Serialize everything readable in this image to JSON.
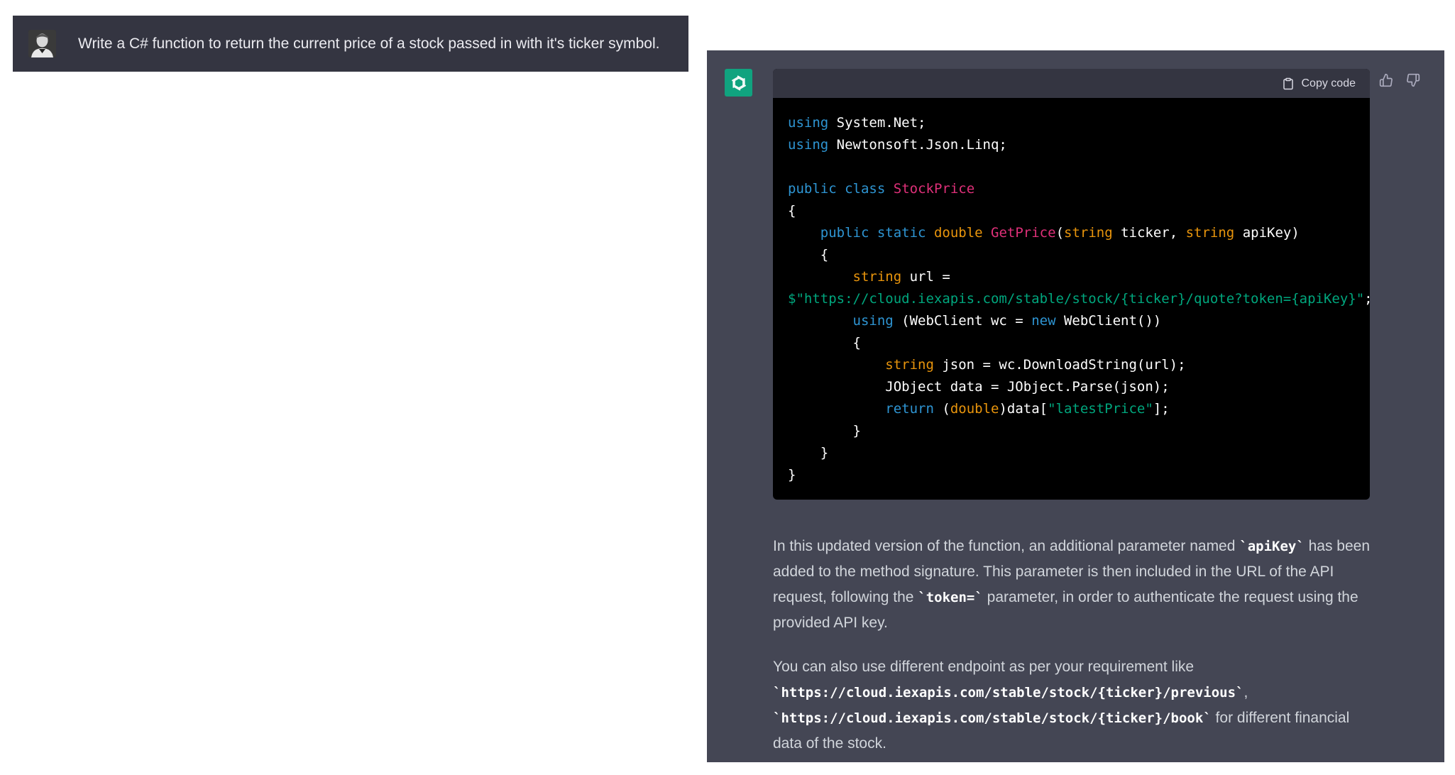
{
  "user": {
    "avatar_icon": "user-avatar",
    "prompt": "Write a C# function to return the current price of a stock passed in with it's ticker symbol."
  },
  "assistant": {
    "avatar_icon": "openai-logo-icon",
    "copy_label": "Copy code",
    "feedback": {
      "thumbs_up_icon": "thumbs-up-icon",
      "thumbs_down_icon": "thumbs-down-icon"
    },
    "code_lines": [
      [
        {
          "t": "kw",
          "v": "using"
        },
        {
          "t": "plain",
          "v": " System.Net;"
        }
      ],
      [
        {
          "t": "kw",
          "v": "using"
        },
        {
          "t": "plain",
          "v": " Newtonsoft.Json.Linq;"
        }
      ],
      [],
      [
        {
          "t": "kw",
          "v": "public"
        },
        {
          "t": "plain",
          "v": " "
        },
        {
          "t": "kw",
          "v": "class"
        },
        {
          "t": "plain",
          "v": " "
        },
        {
          "t": "cls",
          "v": "StockPrice"
        }
      ],
      [
        {
          "t": "plain",
          "v": "{"
        }
      ],
      [
        {
          "t": "plain",
          "v": "    "
        },
        {
          "t": "kw",
          "v": "public"
        },
        {
          "t": "plain",
          "v": " "
        },
        {
          "t": "kw",
          "v": "static"
        },
        {
          "t": "plain",
          "v": " "
        },
        {
          "t": "type",
          "v": "double"
        },
        {
          "t": "plain",
          "v": " "
        },
        {
          "t": "cls",
          "v": "GetPrice"
        },
        {
          "t": "plain",
          "v": "("
        },
        {
          "t": "type",
          "v": "string"
        },
        {
          "t": "plain",
          "v": " ticker, "
        },
        {
          "t": "type",
          "v": "string"
        },
        {
          "t": "plain",
          "v": " apiKey)"
        }
      ],
      [
        {
          "t": "plain",
          "v": "    {"
        }
      ],
      [
        {
          "t": "plain",
          "v": "        "
        },
        {
          "t": "type",
          "v": "string"
        },
        {
          "t": "plain",
          "v": " url ="
        }
      ],
      [
        {
          "t": "str",
          "v": "$\"https://cloud.iexapis.com/stable/stock/{ticker}/quote?token={apiKey}\""
        },
        {
          "t": "plain",
          "v": ";"
        }
      ],
      [
        {
          "t": "plain",
          "v": "        "
        },
        {
          "t": "kw",
          "v": "using"
        },
        {
          "t": "plain",
          "v": " (WebClient wc = "
        },
        {
          "t": "kw",
          "v": "new"
        },
        {
          "t": "plain",
          "v": " WebClient())"
        }
      ],
      [
        {
          "t": "plain",
          "v": "        {"
        }
      ],
      [
        {
          "t": "plain",
          "v": "            "
        },
        {
          "t": "type",
          "v": "string"
        },
        {
          "t": "plain",
          "v": " json = wc.DownloadString(url);"
        }
      ],
      [
        {
          "t": "plain",
          "v": "            JObject data = JObject.Parse(json);"
        }
      ],
      [
        {
          "t": "plain",
          "v": "            "
        },
        {
          "t": "kw",
          "v": "return"
        },
        {
          "t": "plain",
          "v": " ("
        },
        {
          "t": "type",
          "v": "double"
        },
        {
          "t": "plain",
          "v": ")data["
        },
        {
          "t": "str",
          "v": "\"latestPrice\""
        },
        {
          "t": "plain",
          "v": "];"
        }
      ],
      [
        {
          "t": "plain",
          "v": "        }"
        }
      ],
      [
        {
          "t": "plain",
          "v": "    }"
        }
      ],
      [
        {
          "t": "plain",
          "v": "}"
        }
      ]
    ],
    "paragraphs": [
      [
        {
          "t": "text",
          "v": "In this updated version of the function, an additional parameter named "
        },
        {
          "t": "code",
          "v": "`apiKey`"
        },
        {
          "t": "text",
          "v": " has been added to the method signature. This parameter is then included in the URL of the API request, following the "
        },
        {
          "t": "code",
          "v": "`token=`"
        },
        {
          "t": "text",
          "v": " parameter, in order to authenticate the request using the provided API key."
        }
      ],
      [
        {
          "t": "text",
          "v": "You can also use different endpoint as per your requirement like "
        },
        {
          "t": "code",
          "v": "`https://cloud.iexapis.com/stable/stock/{ticker}/previous`"
        },
        {
          "t": "text",
          "v": ", "
        },
        {
          "t": "code",
          "v": "`https://cloud.iexapis.com/stable/stock/{ticker}/book`"
        },
        {
          "t": "text",
          "v": " for different financial data of the stock."
        }
      ]
    ]
  },
  "colors": {
    "user_panel_bg": "#343541",
    "assistant_panel_bg": "#444654",
    "code_bg": "#000000",
    "code_header_bg": "#343541",
    "keyword": "#2e95d3",
    "type": "#e9950c",
    "class_name": "#df3079",
    "string": "#00a67d",
    "openai_green": "#10a37f"
  }
}
